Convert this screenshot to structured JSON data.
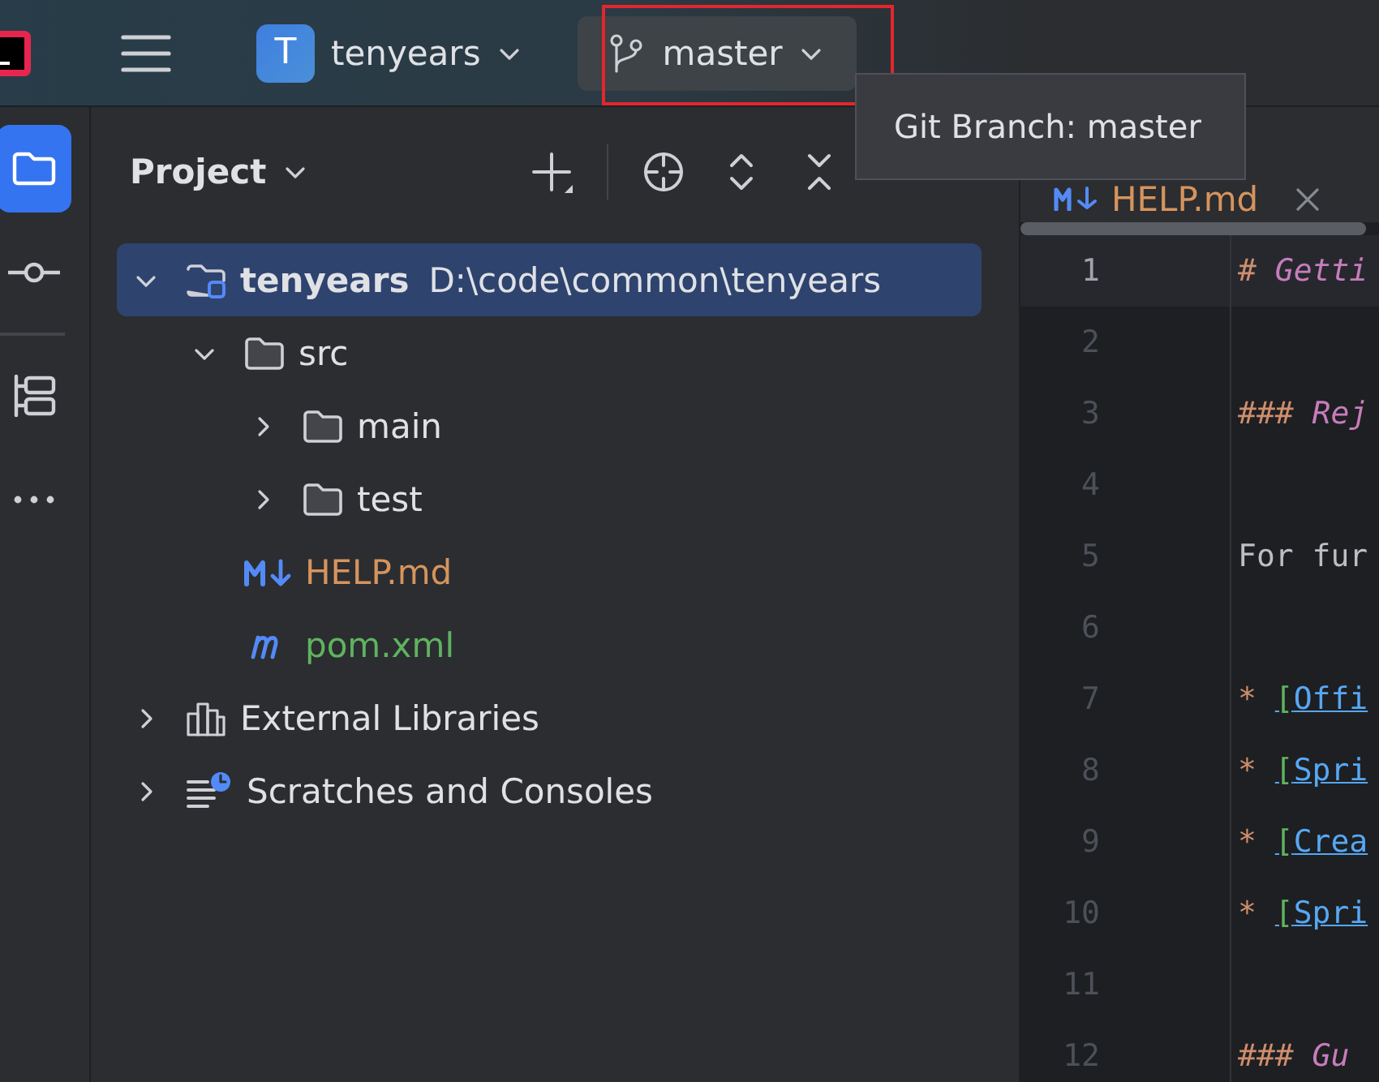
{
  "toolbar": {
    "project": {
      "initial": "T",
      "name": "tenyears"
    },
    "branch": {
      "name": "master",
      "highlighted": true
    }
  },
  "tooltip": {
    "text": "Git Branch: master"
  },
  "tool_strip": [
    {
      "kind": "project",
      "selected": true
    },
    {
      "kind": "commit",
      "selected": false
    },
    {
      "kind": "structure",
      "selected": false
    },
    {
      "kind": "more",
      "selected": false
    }
  ],
  "project_panel": {
    "title": "Project",
    "tree": [
      {
        "kind": "project",
        "name": "tenyears",
        "path": "D:\\code\\common\\tenyears",
        "expanded": true,
        "selected": true,
        "children": [
          {
            "kind": "folder",
            "name": "src",
            "expanded": true,
            "selected": false,
            "children": [
              {
                "kind": "folder",
                "name": "main",
                "expanded": false,
                "selected": false
              },
              {
                "kind": "folder",
                "name": "test",
                "expanded": false,
                "selected": false
              }
            ]
          },
          {
            "kind": "markdown",
            "name": "HELP.md",
            "color": "#d6945d",
            "selected": false
          },
          {
            "kind": "maven",
            "name": "pom.xml",
            "color": "#5fb35f",
            "selected": false
          }
        ]
      },
      {
        "kind": "libraries",
        "name": "External Libraries",
        "expanded": false,
        "selected": false
      },
      {
        "kind": "scratches",
        "name": "Scratches and Consoles",
        "expanded": false,
        "selected": false
      }
    ]
  },
  "editor": {
    "tab": {
      "name": "HELP.md"
    },
    "lines": [
      {
        "number": "1",
        "current": true,
        "segments": [
          {
            "kind": "mark",
            "text": "# "
          },
          {
            "kind": "heading",
            "text": "Getti"
          }
        ]
      },
      {
        "number": "2",
        "current": false
      },
      {
        "number": "3",
        "current": false,
        "segments": [
          {
            "kind": "mark",
            "text": "### "
          },
          {
            "kind": "heading",
            "text": "Rej"
          }
        ]
      },
      {
        "number": "4",
        "current": false
      },
      {
        "number": "5",
        "current": false,
        "segments": [
          {
            "kind": "plain",
            "text": "For fur"
          }
        ]
      },
      {
        "number": "6",
        "current": false
      },
      {
        "number": "7",
        "current": false,
        "segments": [
          {
            "kind": "mark",
            "text": "* "
          },
          {
            "kind": "bracket",
            "text": "["
          },
          {
            "kind": "link",
            "text": "Offi"
          }
        ]
      },
      {
        "number": "8",
        "current": false,
        "segments": [
          {
            "kind": "mark",
            "text": "* "
          },
          {
            "kind": "bracket",
            "text": "["
          },
          {
            "kind": "link",
            "text": "Spri"
          }
        ]
      },
      {
        "number": "9",
        "current": false,
        "segments": [
          {
            "kind": "mark",
            "text": "* "
          },
          {
            "kind": "bracket",
            "text": "["
          },
          {
            "kind": "link",
            "text": "Crea"
          }
        ]
      },
      {
        "number": "10",
        "current": false,
        "segments": [
          {
            "kind": "mark",
            "text": "* "
          },
          {
            "kind": "bracket",
            "text": "["
          },
          {
            "kind": "link",
            "text": "Spri"
          }
        ]
      },
      {
        "number": "11",
        "current": false
      },
      {
        "number": "12",
        "current": false,
        "segments": [
          {
            "kind": "mark",
            "text": "### "
          },
          {
            "kind": "heading",
            "text": "Gu"
          }
        ]
      }
    ]
  }
}
